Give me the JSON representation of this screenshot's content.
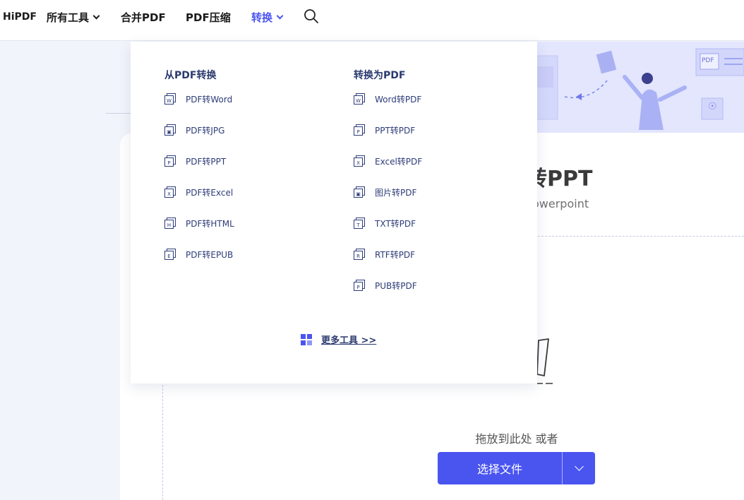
{
  "nav": {
    "brand": "HiPDF",
    "all_tools": "所有工具",
    "merge": "合并PDF",
    "compress": "PDF压缩",
    "convert": "转换"
  },
  "colors": {
    "accent": "#4a55f0",
    "menu_text": "#2d3c78"
  },
  "dropdown": {
    "from_pdf": {
      "heading": "从PDF转换",
      "items": [
        {
          "label": "PDF转Word",
          "icon": "word-doc-icon"
        },
        {
          "label": "PDF转JPG",
          "icon": "image-doc-icon"
        },
        {
          "label": "PDF转PPT",
          "icon": "ppt-doc-icon"
        },
        {
          "label": "PDF转Excel",
          "icon": "excel-doc-icon"
        },
        {
          "label": "PDF转HTML",
          "icon": "html-doc-icon"
        },
        {
          "label": "PDF转EPUB",
          "icon": "epub-doc-icon"
        }
      ]
    },
    "to_pdf": {
      "heading": "转换为PDF",
      "items": [
        {
          "label": "Word转PDF",
          "icon": "word-doc-icon"
        },
        {
          "label": "PPT转PDF",
          "icon": "ppt-doc-icon"
        },
        {
          "label": "Excel转PDF",
          "icon": "excel-doc-icon"
        },
        {
          "label": "图片转PDF",
          "icon": "image-doc-icon"
        },
        {
          "label": "TXT转PDF",
          "icon": "txt-doc-icon"
        },
        {
          "label": "RTF转PDF",
          "icon": "rtf-doc-icon"
        },
        {
          "label": "PUB转PDF",
          "icon": "pub-doc-icon"
        }
      ]
    },
    "more_tools": "更多工具 >>"
  },
  "page": {
    "title_fragment": "转PPT",
    "subtitle_fragment": "owerpoint",
    "hero_badge": "PDF",
    "drop_text": "拖放到此处 或者",
    "choose_file": "选择文件"
  }
}
